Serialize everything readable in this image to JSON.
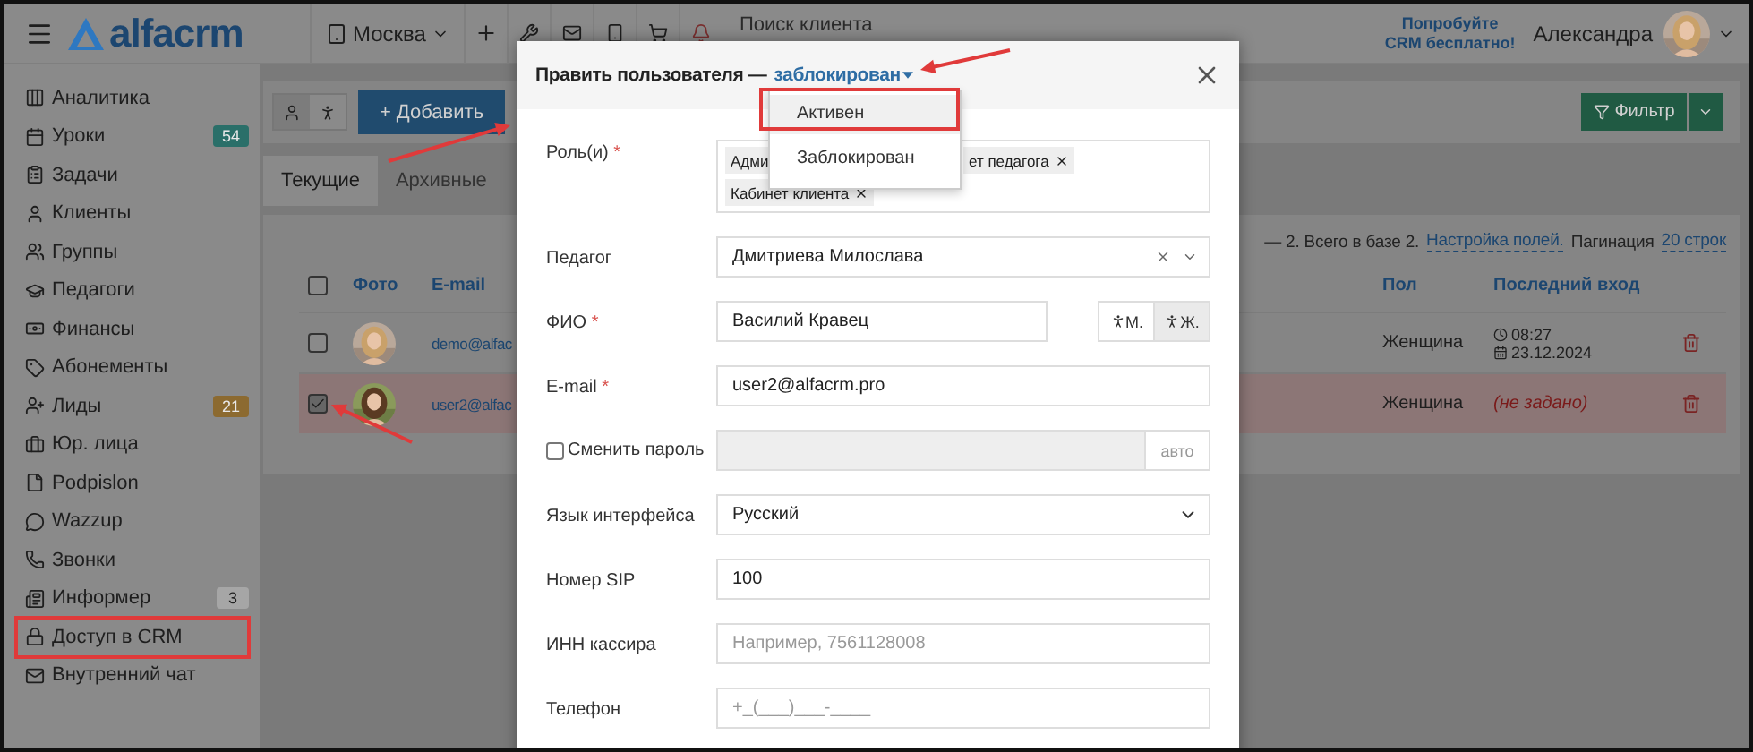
{
  "header": {
    "logo": "alfacrm",
    "city": "Москва",
    "search_placeholder": "Поиск клиента",
    "promo_lines": [
      "Попробуйте",
      "CRM бесплатно!"
    ],
    "user": "Александра"
  },
  "sidebar": {
    "items": [
      {
        "label": "Аналитика"
      },
      {
        "label": "Уроки",
        "badge": "54",
        "color": "#2a6f69"
      },
      {
        "label": "Задачи"
      },
      {
        "label": "Клиенты"
      },
      {
        "label": "Группы"
      },
      {
        "label": "Педагоги"
      },
      {
        "label": "Финансы"
      },
      {
        "label": "Абонементы"
      },
      {
        "label": "Лиды",
        "badge": "21",
        "color": "#8c6a30"
      },
      {
        "label": "Юр. лица"
      },
      {
        "label": "Podpislon"
      },
      {
        "label": "Wazzup"
      },
      {
        "label": "Звонки"
      },
      {
        "label": "Информер",
        "badge": "3",
        "color": "#a6a6a6"
      },
      {
        "label": "Доступ в CRM"
      },
      {
        "label": "Внутренний чат"
      }
    ]
  },
  "toolbar": {
    "view_toggle": [
      {
        "selected": true
      },
      {
        "selected": false
      }
    ],
    "add_button": "+ Добавить",
    "filter_button": "Фильтр"
  },
  "tabs": [
    {
      "label": "Текущие",
      "selected": true
    },
    {
      "label": "Архивные",
      "selected": false
    }
  ],
  "summary": {
    "range": "— 2. Всего в базе 2.",
    "fields_link": "Настройка полей.",
    "pagination_label": "Пагинация",
    "pagination_link": "20 строк"
  },
  "table": {
    "all_checked": false,
    "columns": [
      "Фото",
      "E-mail",
      "Пол",
      "Последний вход"
    ],
    "rows": [
      {
        "checked": false,
        "email": "demo@alfac",
        "gender": "Женщина",
        "last_login": {
          "kind": "datetime",
          "time": "08:27",
          "date": "23.12.2024"
        }
      },
      {
        "checked": true,
        "email": "user2@alfac",
        "gender": "Женщина",
        "last_login": {
          "kind": "unset",
          "text": "(не задано)"
        }
      }
    ]
  },
  "modal": {
    "title": "Править пользователя —",
    "status": "заблокирован",
    "status_menu": [
      {
        "label": "Активен",
        "selected": true
      },
      {
        "label": "Заблокирован",
        "selected": false
      }
    ],
    "fields": [
      {
        "kind": "tags",
        "label": "Роль(и)",
        "required_mark": "*",
        "tags": [
          {
            "text": "Адми",
            "cut": true
          },
          {
            "text": "ет педагога",
            "cut": false
          },
          {
            "text": "Кабинет клиента",
            "cut": false
          }
        ]
      },
      {
        "kind": "select",
        "label": "Педагог",
        "value": "Дмитриева Милослава"
      },
      {
        "kind": "name",
        "label": "ФИО",
        "required_mark": "*",
        "value": "Василий Кравец",
        "genders": [
          {
            "label": "М.",
            "selected": false
          },
          {
            "label": "Ж.",
            "selected": true
          }
        ]
      },
      {
        "kind": "text",
        "label": "E-mail",
        "required_mark": "*",
        "value": "user2@alfacrm.pro"
      },
      {
        "kind": "password",
        "label": "Сменить пароль",
        "checked": false,
        "addon": "авто"
      },
      {
        "kind": "native-select",
        "label": "Язык интерфейса",
        "value": "Русский"
      },
      {
        "kind": "text",
        "label": "Номер SIP",
        "value": "100"
      },
      {
        "kind": "text",
        "label": "ИНН кассира",
        "placeholder": "Например, 7561128008"
      },
      {
        "kind": "text",
        "label": "Телефон",
        "placeholder": "+_(___)___-____"
      }
    ]
  }
}
